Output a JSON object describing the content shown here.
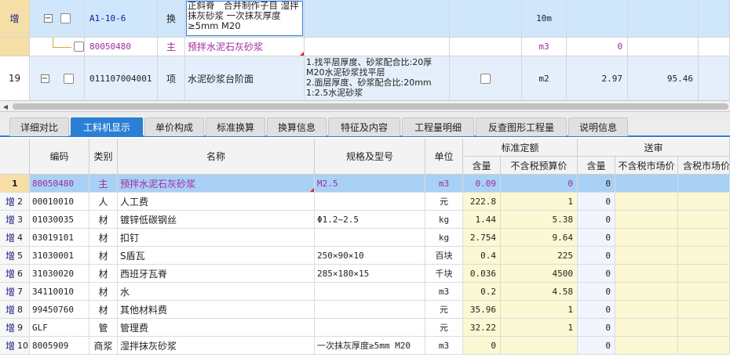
{
  "top_rows": [
    {
      "indicator": "增",
      "code": "A1-10-6",
      "type": "换",
      "name": "正斜脊　合并制作子目 湿拌抹灰砂浆 一次抹灰厚度≥5mm M20",
      "features": "",
      "unit": "10m",
      "quantity": "",
      "price": ""
    },
    {
      "indicator": "",
      "code": "80050480",
      "type": "主",
      "name": "预拌水泥石灰砂浆",
      "features": "",
      "unit": "m3",
      "quantity": "0",
      "price": ""
    },
    {
      "indicator": "19",
      "code": "011107004001",
      "type": "项",
      "name": "水泥砂浆台阶面",
      "features": "1.找平层厚度、砂浆配合比:20厚M20水泥砂浆找平层\n2.面层厚度、砂浆配合比:20mm 1:2.5水泥砂浆",
      "unit": "m2",
      "quantity": "2.97",
      "price": "95.46"
    }
  ],
  "tabs": [
    {
      "label": "详细对比",
      "active": false
    },
    {
      "label": "工料机显示",
      "active": true
    },
    {
      "label": "单价构成",
      "active": false
    },
    {
      "label": "标准换算",
      "active": false
    },
    {
      "label": "换算信息",
      "active": false
    },
    {
      "label": "特征及内容",
      "active": false
    },
    {
      "label": "工程量明细",
      "active": false
    },
    {
      "label": "反查图形工程量",
      "active": false
    },
    {
      "label": "说明信息",
      "active": false
    }
  ],
  "columns": {
    "code": "编码",
    "category": "类别",
    "name": "名称",
    "spec": "规格及型号",
    "unit": "单位",
    "std_group": "标准定额",
    "std_qty": "含量",
    "std_price": "不含税预算价",
    "review_group": "送审",
    "rev_qty": "含量",
    "rev_market": "不含税市场价",
    "rev_tax_market": "含税市场价"
  },
  "rows": [
    {
      "idx": "1",
      "prefix": "",
      "code": "80050480",
      "cat": "主",
      "name": "预拌水泥石灰砂浆",
      "spec": "M2.5",
      "unit": "m3",
      "qty": "0.09",
      "price": "0",
      "rqty": "0",
      "purple": true
    },
    {
      "idx": "2",
      "prefix": "增",
      "code": "00010010",
      "cat": "人",
      "name": "人工费",
      "spec": "",
      "unit": "元",
      "qty": "222.8",
      "price": "1",
      "rqty": "0",
      "purple": false
    },
    {
      "idx": "3",
      "prefix": "增",
      "code": "01030035",
      "cat": "材",
      "name": "镀锌低碳钢丝",
      "spec": "Φ1.2~2.5",
      "unit": "kg",
      "qty": "1.44",
      "price": "5.38",
      "rqty": "0",
      "purple": false
    },
    {
      "idx": "4",
      "prefix": "增",
      "code": "03019101",
      "cat": "材",
      "name": "扣钉",
      "spec": "",
      "unit": "kg",
      "qty": "2.754",
      "price": "9.64",
      "rqty": "0",
      "purple": false
    },
    {
      "idx": "5",
      "prefix": "增",
      "code": "31030001",
      "cat": "材",
      "name": "S盾瓦",
      "spec": "250×90×10",
      "unit": "百块",
      "qty": "0.4",
      "price": "225",
      "rqty": "0",
      "purple": false
    },
    {
      "idx": "6",
      "prefix": "增",
      "code": "31030020",
      "cat": "材",
      "name": "西班牙瓦脊",
      "spec": "285×180×15",
      "unit": "千块",
      "qty": "0.036",
      "price": "4500",
      "rqty": "0",
      "purple": false
    },
    {
      "idx": "7",
      "prefix": "增",
      "code": "34110010",
      "cat": "材",
      "name": "水",
      "spec": "",
      "unit": "m3",
      "qty": "0.2",
      "price": "4.58",
      "rqty": "0",
      "purple": false
    },
    {
      "idx": "8",
      "prefix": "增",
      "code": "99450760",
      "cat": "材",
      "name": "其他材料费",
      "spec": "",
      "unit": "元",
      "qty": "35.96",
      "price": "1",
      "rqty": "0",
      "purple": false
    },
    {
      "idx": "9",
      "prefix": "增",
      "code": "GLF",
      "cat": "管",
      "name": "管理费",
      "spec": "",
      "unit": "元",
      "qty": "32.22",
      "price": "1",
      "rqty": "0",
      "purple": false
    },
    {
      "idx": "10",
      "prefix": "增",
      "code": "8005909",
      "cat": "商浆",
      "name": "湿拌抹灰砂浆",
      "spec": "一次抹灰厚度≥5mm M20",
      "unit": "m3",
      "qty": "0",
      "price": "",
      "rqty": "0",
      "purple": false
    }
  ],
  "colors": {
    "accent": "#2b7fd4",
    "selected_row": "#a9d0f5",
    "purple_text": "#a02ca0",
    "code_blue": "#1414b4"
  }
}
